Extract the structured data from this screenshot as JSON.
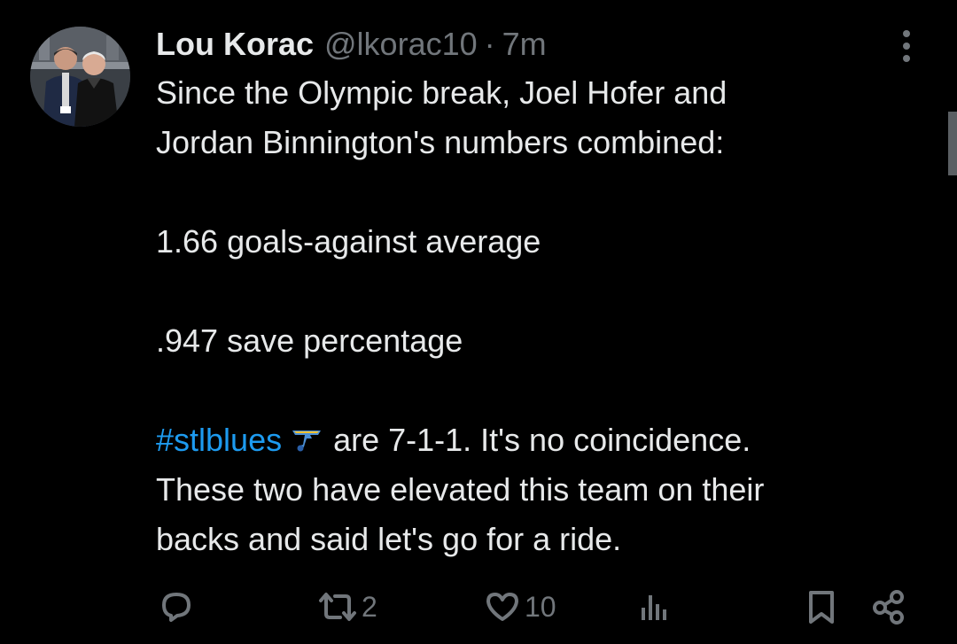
{
  "tweet": {
    "author": {
      "display_name": "Lou Korac",
      "handle": "@lkorac10",
      "separator": "·",
      "time_ago": "7m"
    },
    "lines": [
      "Since the Olympic break, Joel Hofer and",
      "Jordan Binnington's numbers combined:",
      "1.66 goals-against average",
      ".947 save percentage"
    ],
    "hashtag": "#stlblues",
    "hashtag_emoji": "blues-note-emoji",
    "after_hashtag": "are 7-1-1. It's no coincidence.",
    "closing_lines": [
      "These two have elevated this team on their",
      "backs and said let's go for a ride."
    ],
    "actions": {
      "reply_count": "",
      "retweet_count": "2",
      "like_count": "10",
      "views_count": ""
    }
  },
  "icons": {
    "reply": "reply-icon",
    "retweet": "retweet-icon",
    "like": "heart-icon",
    "views": "views-icon",
    "bookmark": "bookmark-icon",
    "share": "share-icon",
    "more": "more-icon"
  },
  "colors": {
    "background": "#000000",
    "text": "#e7e9ea",
    "muted": "#71767b",
    "link": "#1d9bf0"
  }
}
